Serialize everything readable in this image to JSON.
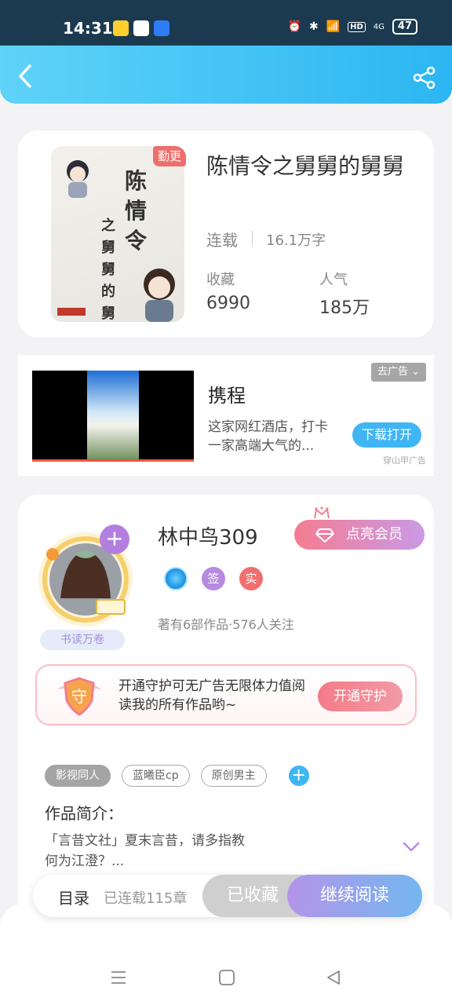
{
  "status_bar": {
    "time": "14:31",
    "hd": "HD",
    "network": "4G",
    "battery": "47"
  },
  "book": {
    "badge": "勤更",
    "cover_title": "陈情令",
    "cover_subtitle": "之舅舅的舅舅",
    "title": "陈情令之舅舅的舅舅",
    "status": "连载",
    "word_count": "16.1万字",
    "stats": [
      {
        "label": "收藏",
        "value": "6990"
      },
      {
        "label": "人气",
        "value": "185万"
      }
    ]
  },
  "ad": {
    "remove_label": "去广告",
    "title": "携程",
    "description": "这家网红酒店，打卡一家高端大气的...",
    "download_label": "下载打开",
    "source": "穿山甲广告"
  },
  "author": {
    "name": "林中鸟309",
    "avatar_tag": "书读万卷",
    "vip_label": "点亮会员",
    "badges": [
      "签",
      "实"
    ],
    "stats": "著有6部作品·576人关注",
    "guard_text": "开通守护可无广告无限体力值阅读我的所有作品哟~",
    "guard_icon_char": "守",
    "guard_button": "开通守护",
    "tags": [
      "影视同人",
      "蓝曦臣cp",
      "原创男主"
    ],
    "intro_label": "作品简介：",
    "intro_text": "「言昔文社」夏末言昔，请多指教\n何为江澄？..."
  },
  "bottom_bar": {
    "toc_label": "目录",
    "chapters": "已连载115章",
    "collected_label": "已收藏",
    "continue_label": "继续阅读"
  },
  "colors": {
    "accent": "#2cb6f2",
    "purple": "#b27fe0",
    "pink": "#f47d91"
  }
}
